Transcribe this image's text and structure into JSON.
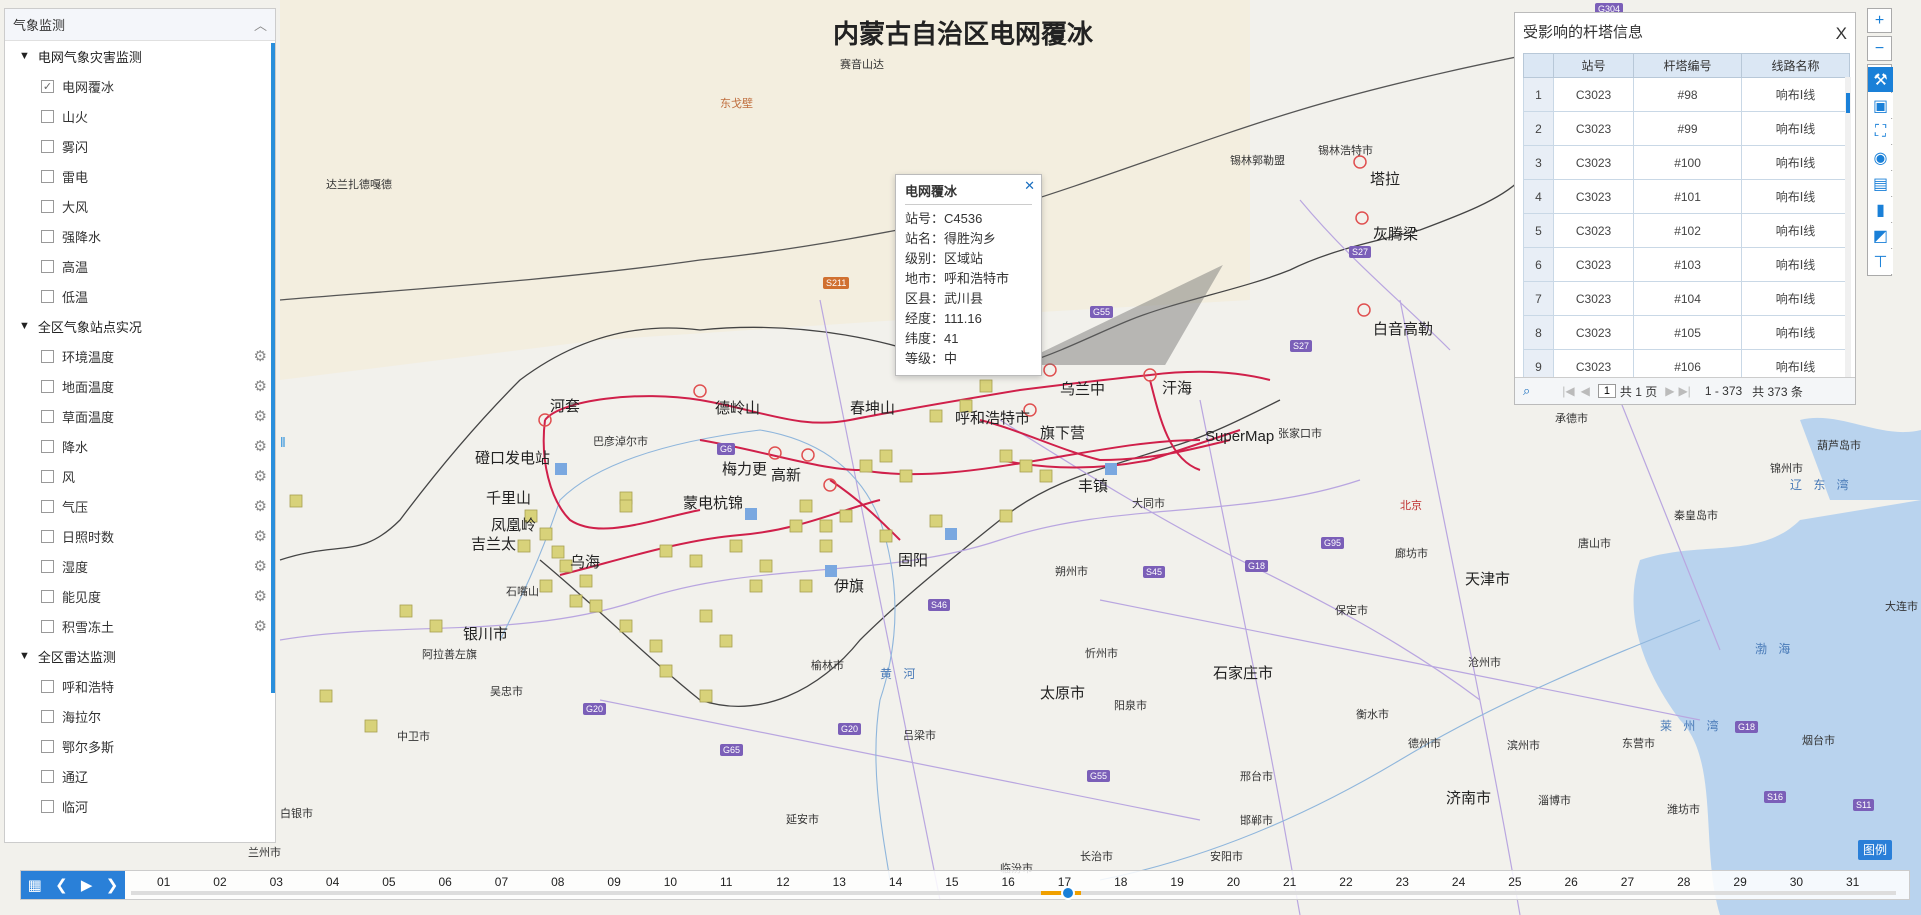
{
  "title": "内蒙古自治区电网覆冰",
  "left_panel": {
    "header": "气象监测",
    "groups": [
      {
        "title": "电网气象灾害监测",
        "items": [
          {
            "label": "电网覆冰",
            "checked": true
          },
          {
            "label": "山火",
            "checked": false
          },
          {
            "label": "雾闪",
            "checked": false
          },
          {
            "label": "雷电",
            "checked": false
          },
          {
            "label": "大风",
            "checked": false
          },
          {
            "label": "强降水",
            "checked": false
          },
          {
            "label": "高温",
            "checked": false
          },
          {
            "label": "低温",
            "checked": false
          }
        ]
      },
      {
        "title": "全区气象站点实况",
        "items": [
          {
            "label": "环境温度"
          },
          {
            "label": "地面温度"
          },
          {
            "label": "草面温度"
          },
          {
            "label": "降水"
          },
          {
            "label": "风"
          },
          {
            "label": "气压"
          },
          {
            "label": "日照时数"
          },
          {
            "label": "湿度"
          },
          {
            "label": "能见度"
          },
          {
            "label": "积雪冻土"
          }
        ]
      },
      {
        "title": "全区雷达监测",
        "items": [
          {
            "label": "呼和浩特"
          },
          {
            "label": "海拉尔"
          },
          {
            "label": "鄂尔多斯"
          },
          {
            "label": "通辽"
          },
          {
            "label": "临河"
          }
        ]
      }
    ]
  },
  "popup": {
    "title": "电网覆冰",
    "close": "✕",
    "rows": [
      "站号：C4536",
      "站名：得胜沟乡",
      "级别：区域站",
      "地市：呼和浩特市",
      "区县：武川县",
      "经度：111.16",
      "纬度：41",
      "等级：中"
    ]
  },
  "tower_panel": {
    "title": "受影响的杆塔信息",
    "close": "X",
    "columns": [
      "",
      "站号",
      "杆塔编号",
      "线路名称"
    ],
    "rows": [
      [
        "1",
        "C3023",
        "#98",
        "响布Ⅰ线"
      ],
      [
        "2",
        "C3023",
        "#99",
        "响布Ⅰ线"
      ],
      [
        "3",
        "C3023",
        "#100",
        "响布Ⅰ线"
      ],
      [
        "4",
        "C3023",
        "#101",
        "响布Ⅰ线"
      ],
      [
        "5",
        "C3023",
        "#102",
        "响布Ⅰ线"
      ],
      [
        "6",
        "C3023",
        "#103",
        "响布Ⅰ线"
      ],
      [
        "7",
        "C3023",
        "#104",
        "响布Ⅰ线"
      ],
      [
        "8",
        "C3023",
        "#105",
        "响布Ⅰ线"
      ],
      [
        "9",
        "C3023",
        "#106",
        "响布Ⅰ线"
      ]
    ],
    "footer": {
      "page_input": "1",
      "total_pages": "共 1 页",
      "range": "1 - 373",
      "total": "共 373 条"
    }
  },
  "legend_label": "图例",
  "timeline": {
    "days": [
      "01",
      "02",
      "03",
      "04",
      "05",
      "06",
      "07",
      "08",
      "09",
      "10",
      "11",
      "12",
      "13",
      "14",
      "15",
      "16",
      "17",
      "18",
      "19",
      "20",
      "21",
      "22",
      "23",
      "24",
      "25",
      "26",
      "27",
      "28",
      "29",
      "30",
      "31"
    ],
    "current_day": "17"
  },
  "map_labels": {
    "cities": [
      "河套",
      "德岭山",
      "春坤山",
      "呼和浩特市",
      "旗下营",
      "乌兰中",
      "汗海",
      "梅力更",
      "高新",
      "磴口发电站",
      "千里山",
      "凤凰岭",
      "吉兰太",
      "石嘴山",
      "乌海",
      "伊旗",
      "固阳",
      "丰镇",
      "SuperMap",
      "张家口市",
      "承德市",
      "北京",
      "廊坊市",
      "天津市",
      "唐山市",
      "秦皇岛市",
      "保定市",
      "石家庄市",
      "沧州市",
      "衡水市",
      "德州市",
      "滨州市",
      "东营市",
      "济南市",
      "淄博市",
      "潍坊市",
      "烟台市",
      "邢台市",
      "邯郸市",
      "安阳市",
      "长治市",
      "太原市",
      "阳泉市",
      "忻州市",
      "朔州市",
      "大同市",
      "吕梁市",
      "榆林市",
      "银川市",
      "吴忠市",
      "中卫市",
      "白银市",
      "兰州市",
      "延安市",
      "临汾市",
      "锡林郭勒盟",
      "锡林浩特市",
      "塔拉",
      "灰腾梁",
      "白音高勒",
      "赛音山达",
      "达兰扎德嘎德",
      "东戈壁",
      "葫芦岛市",
      "锦州市",
      "大连市",
      "巴彦淖尔市",
      "蒙电杭锦",
      "阿拉善左旗"
    ],
    "seas": [
      "辽 东 湾",
      "渤 海",
      "莱 州 湾",
      "黄 河"
    ]
  },
  "colors": {
    "accent": "#1a80d8",
    "power_line": "#d0204a",
    "province_border": "#444444",
    "road": "#b9a6e0"
  }
}
